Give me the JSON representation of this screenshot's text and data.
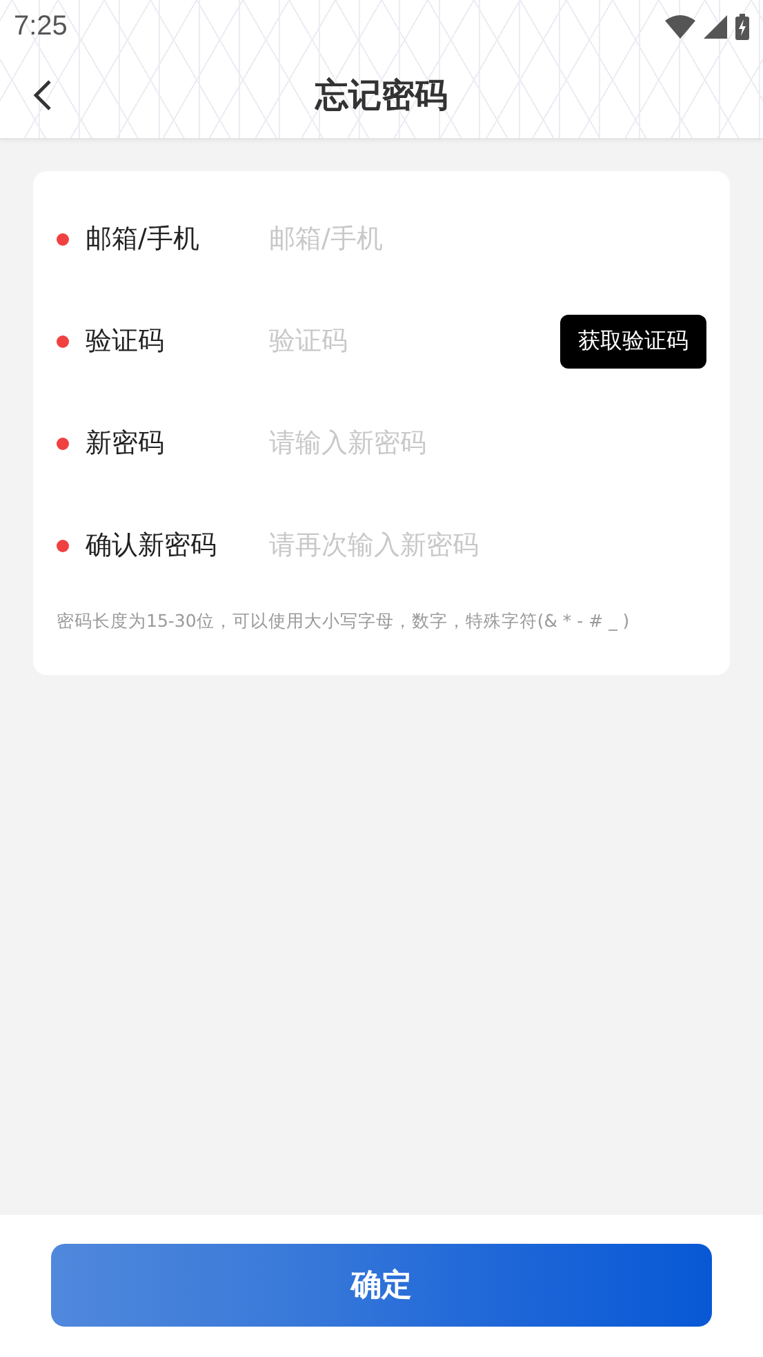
{
  "status_bar": {
    "time": "7:25"
  },
  "header": {
    "title": "忘记密码"
  },
  "fields": [
    {
      "label": "邮箱/手机",
      "placeholder": "邮箱/手机",
      "required": true,
      "kind": "text"
    },
    {
      "label": "验证码",
      "placeholder": "验证码",
      "required": true,
      "kind": "code",
      "button": "获取验证码"
    },
    {
      "label": "新密码",
      "placeholder": "请输入新密码",
      "required": true,
      "kind": "password"
    },
    {
      "label": "确认新密码",
      "placeholder": "请再次输入新密码",
      "required": true,
      "kind": "password"
    }
  ],
  "hint": "密码长度为15-30位，可以使用大小写字母，数字，特殊字符(& * - # _ )",
  "submit": "确定"
}
